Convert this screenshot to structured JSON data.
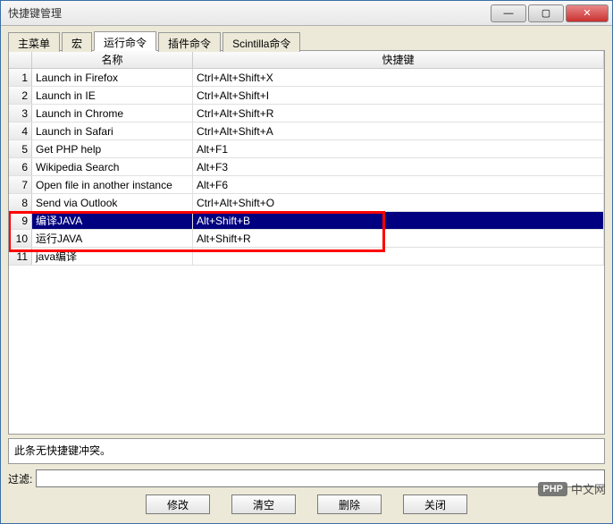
{
  "window": {
    "title": "快捷键管理"
  },
  "tabs": [
    {
      "label": "主菜单",
      "active": false
    },
    {
      "label": "宏",
      "active": false
    },
    {
      "label": "运行命令",
      "active": true
    },
    {
      "label": "插件命令",
      "active": false
    },
    {
      "label": "Scintilla命令",
      "active": false
    }
  ],
  "columns": {
    "name": "名称",
    "shortcut": "快捷键"
  },
  "rows": [
    {
      "no": "1",
      "name": "Launch in Firefox",
      "key": "Ctrl+Alt+Shift+X",
      "selected": false
    },
    {
      "no": "2",
      "name": "Launch in IE",
      "key": "Ctrl+Alt+Shift+I",
      "selected": false
    },
    {
      "no": "3",
      "name": "Launch in Chrome",
      "key": "Ctrl+Alt+Shift+R",
      "selected": false
    },
    {
      "no": "4",
      "name": "Launch in Safari",
      "key": "Ctrl+Alt+Shift+A",
      "selected": false
    },
    {
      "no": "5",
      "name": "Get PHP help",
      "key": "Alt+F1",
      "selected": false
    },
    {
      "no": "6",
      "name": "Wikipedia Search",
      "key": "Alt+F3",
      "selected": false
    },
    {
      "no": "7",
      "name": "Open file in another instance",
      "key": "Alt+F6",
      "selected": false
    },
    {
      "no": "8",
      "name": "Send via Outlook",
      "key": "Ctrl+Alt+Shift+O",
      "selected": false
    },
    {
      "no": "9",
      "name": "编译JAVA",
      "key": "Alt+Shift+B",
      "selected": true
    },
    {
      "no": "10",
      "name": "运行JAVA",
      "key": "Alt+Shift+R",
      "selected": false
    },
    {
      "no": "11",
      "name": "java编译",
      "key": "",
      "selected": false
    }
  ],
  "status": "此条无快捷键冲突。",
  "filter": {
    "label": "过滤:",
    "value": ""
  },
  "buttons": {
    "modify": "修改",
    "clear": "清空",
    "delete": "删除",
    "close": "关闭"
  },
  "watermark": {
    "badge": "PHP",
    "text": "中文网"
  }
}
